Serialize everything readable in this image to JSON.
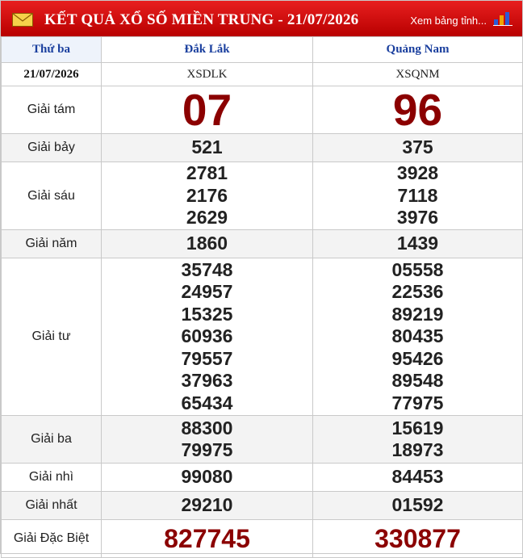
{
  "header": {
    "title": "KẾT QUẢ XỔ SỐ MIỀN TRUNG - 21/07/2026",
    "more_link": "Xem bảng tỉnh...",
    "icons": [
      "mail-icon",
      "bar-chart-icon"
    ],
    "colors": {
      "bar": "#d40000",
      "jackpot": "#8b0000",
      "heading_text": "#1a3f9e"
    }
  },
  "table": {
    "day_label": "Thứ ba",
    "date": "21/07/2026",
    "provinces": [
      {
        "name": "Đắk Lắk",
        "code": "XSDLK"
      },
      {
        "name": "Quảng Nam",
        "code": "XSQNM"
      }
    ],
    "prizes": [
      {
        "label": "Giải tám",
        "style": "big",
        "values": [
          [
            "07"
          ],
          [
            "96"
          ]
        ]
      },
      {
        "label": "Giải bảy",
        "style": "num",
        "values": [
          [
            "521"
          ],
          [
            "375"
          ]
        ]
      },
      {
        "label": "Giải sáu",
        "style": "num",
        "values": [
          [
            "2781",
            "2176",
            "2629"
          ],
          [
            "3928",
            "7118",
            "3976"
          ]
        ]
      },
      {
        "label": "Giải năm",
        "style": "num",
        "values": [
          [
            "1860"
          ],
          [
            "1439"
          ]
        ]
      },
      {
        "label": "Giải tư",
        "style": "num",
        "values": [
          [
            "35748",
            "24957",
            "15325",
            "60936",
            "79557",
            "37963",
            "65434"
          ],
          [
            "05558",
            "22536",
            "89219",
            "80435",
            "95426",
            "89548",
            "77975"
          ]
        ]
      },
      {
        "label": "Giải ba",
        "style": "num",
        "values": [
          [
            "88300",
            "79975"
          ],
          [
            "15619",
            "18973"
          ]
        ]
      },
      {
        "label": "Giải nhì",
        "style": "num",
        "values": [
          [
            "99080"
          ],
          [
            "84453"
          ]
        ]
      },
      {
        "label": "Giải nhất",
        "style": "num",
        "values": [
          [
            "29210"
          ],
          [
            "01592"
          ]
        ]
      },
      {
        "label": "Giải Đặc Biệt",
        "style": "jackpot",
        "values": [
          [
            "827745"
          ],
          [
            "330877"
          ]
        ]
      }
    ]
  }
}
